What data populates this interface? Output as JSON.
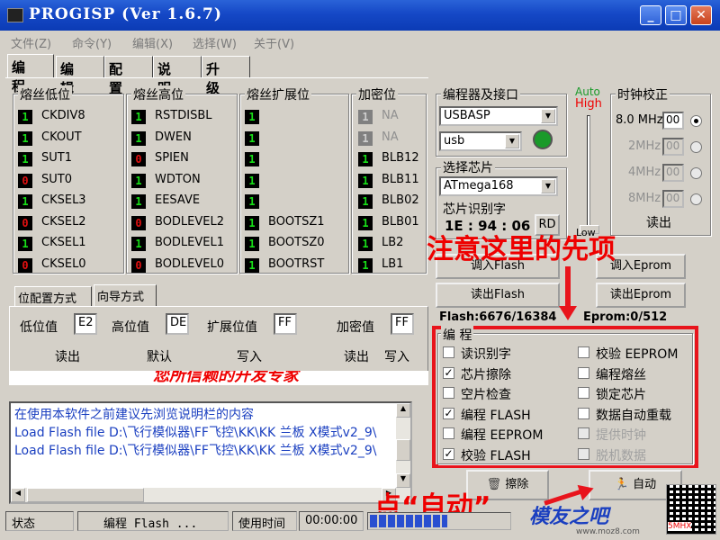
{
  "app": {
    "title": "PROGISP  (Ver 1.6.7)"
  },
  "menu": [
    "文件(Z)",
    "命令(Y)",
    "编辑(X)",
    "选择(W)",
    "关于(V)"
  ],
  "tabs": [
    "编 程",
    "编 辑",
    "配 置",
    "说 明",
    "升 级"
  ],
  "fuse_low": {
    "title": "熔丝低位",
    "items": [
      {
        "bit": "1",
        "label": "CKDIV8",
        "color": "green"
      },
      {
        "bit": "1",
        "label": "CKOUT",
        "color": "green"
      },
      {
        "bit": "1",
        "label": "SUT1",
        "color": "green"
      },
      {
        "bit": "0",
        "label": "SUT0",
        "color": "red"
      },
      {
        "bit": "1",
        "label": "CKSEL3",
        "color": "green"
      },
      {
        "bit": "0",
        "label": "CKSEL2",
        "color": "red"
      },
      {
        "bit": "1",
        "label": "CKSEL1",
        "color": "green"
      },
      {
        "bit": "0",
        "label": "CKSEL0",
        "color": "red"
      }
    ]
  },
  "fuse_high": {
    "title": "熔丝高位",
    "items": [
      {
        "bit": "1",
        "label": "RSTDISBL",
        "color": "green"
      },
      {
        "bit": "1",
        "label": "DWEN",
        "color": "green"
      },
      {
        "bit": "0",
        "label": "SPIEN",
        "color": "red"
      },
      {
        "bit": "1",
        "label": "WDTON",
        "color": "green"
      },
      {
        "bit": "1",
        "label": "EESAVE",
        "color": "green"
      },
      {
        "bit": "0",
        "label": "BODLEVEL2",
        "color": "red"
      },
      {
        "bit": "1",
        "label": "BODLEVEL1",
        "color": "green"
      },
      {
        "bit": "0",
        "label": "BODLEVEL0",
        "color": "red"
      }
    ]
  },
  "fuse_ext": {
    "title": "熔丝扩展位",
    "items": [
      {
        "bit": "1",
        "label": "",
        "color": "green"
      },
      {
        "bit": "1",
        "label": "",
        "color": "green"
      },
      {
        "bit": "1",
        "label": "",
        "color": "green"
      },
      {
        "bit": "1",
        "label": "",
        "color": "green"
      },
      {
        "bit": "1",
        "label": "",
        "color": "green"
      },
      {
        "bit": "1",
        "label": "BOOTSZ1",
        "color": "green"
      },
      {
        "bit": "1",
        "label": "BOOTSZ0",
        "color": "green"
      },
      {
        "bit": "1",
        "label": "BOOTRST",
        "color": "green"
      }
    ]
  },
  "lock": {
    "title": "加密位",
    "items": [
      {
        "bit": "1",
        "label": "NA",
        "color": "gray"
      },
      {
        "bit": "1",
        "label": "NA",
        "color": "gray"
      },
      {
        "bit": "1",
        "label": "BLB12",
        "color": "green"
      },
      {
        "bit": "1",
        "label": "BLB11",
        "color": "green"
      },
      {
        "bit": "1",
        "label": "BLB02",
        "color": "green"
      },
      {
        "bit": "1",
        "label": "BLB01",
        "color": "green"
      },
      {
        "bit": "1",
        "label": "LB2",
        "color": "green"
      },
      {
        "bit": "1",
        "label": "LB1",
        "color": "green"
      }
    ]
  },
  "mode_tabs": [
    "位配置方式",
    "向导方式"
  ],
  "values": {
    "low_label": "低位值",
    "low": "E2",
    "high_label": "高位值",
    "high": "DE",
    "ext_label": "扩展位值",
    "ext": "FF",
    "lock_label": "加密值",
    "lock": "FF"
  },
  "value_buttons": {
    "read": "读出",
    "default": "默认",
    "write": "写入",
    "lock_read": "读出",
    "lock_write": "写入"
  },
  "banner_partial": "您所信赖的开发专家",
  "programmer": {
    "title": "编程器及接口",
    "device": "USBASP",
    "port": "usb",
    "led_color": "#1a9a2a"
  },
  "chip": {
    "title": "选择芯片",
    "value": "ATmega168",
    "sig_title": "芯片识别字",
    "signature": "1E : 94 : 06",
    "rd": "RD"
  },
  "slider": {
    "auto": "Auto",
    "high": "High",
    "low": "Low"
  },
  "clock": {
    "title": "时钟校正",
    "rows": [
      {
        "label": "8.0 MHz",
        "val": "00",
        "selected": true
      },
      {
        "label": "2MHz",
        "val": "00",
        "selected": false
      },
      {
        "label": "4MHz",
        "val": "00",
        "selected": false
      },
      {
        "label": "8MHz",
        "val": "00",
        "selected": false
      }
    ],
    "read": "读出"
  },
  "annotation_top": "注意这里的先项",
  "buttons": {
    "load_flash": "调入Flash",
    "load_eprom": "调入Eprom",
    "read_flash": "读出Flash",
    "read_eprom": "读出Eprom",
    "erase": "擦除",
    "auto": "自动"
  },
  "sizes": {
    "flash": "Flash:6676/16384",
    "eprom": "Eprom:0/512"
  },
  "program": {
    "title": "编 程",
    "left": [
      {
        "label": "读识别字",
        "checked": false,
        "enabled": true
      },
      {
        "label": "芯片擦除",
        "checked": true,
        "enabled": true
      },
      {
        "label": "空片检查",
        "checked": false,
        "enabled": true
      },
      {
        "label": "编程 FLASH",
        "checked": true,
        "enabled": true
      },
      {
        "label": "编程 EEPROM",
        "checked": false,
        "enabled": true
      },
      {
        "label": "校验 FLASH",
        "checked": true,
        "enabled": true
      }
    ],
    "right": [
      {
        "label": "校验 EEPROM",
        "checked": false,
        "enabled": true
      },
      {
        "label": "编程熔丝",
        "checked": false,
        "enabled": true
      },
      {
        "label": "锁定芯片",
        "checked": false,
        "enabled": true
      },
      {
        "label": "数据自动重载",
        "checked": false,
        "enabled": true
      },
      {
        "label": "提供时钟",
        "checked": false,
        "enabled": false
      },
      {
        "label": "脱机数据",
        "checked": false,
        "enabled": false
      }
    ]
  },
  "log": [
    "在使用本软件之前建议先浏览说明栏的内容",
    "Load Flash file D:\\飞行模似器\\FF飞控\\KK\\KK 兰板 X模式v2_9\\",
    "Load Flash file D:\\飞行模似器\\FF飞控\\KK\\KK 兰板 X模式v2_9\\"
  ],
  "annotation_bottom": "点“自动”",
  "watermark": {
    "brand": "模友之吧",
    "url": "www.moz8.com",
    "code": "5MHX"
  },
  "status": {
    "label": "状态",
    "operation": "编程 Flash ...",
    "time_label": "使用时间",
    "time": "00:00:00",
    "progress": 0.55
  },
  "colors": {
    "annotation": "#e8141c",
    "title_bar": "#1548c6",
    "log_text": "#1a3fc0"
  }
}
